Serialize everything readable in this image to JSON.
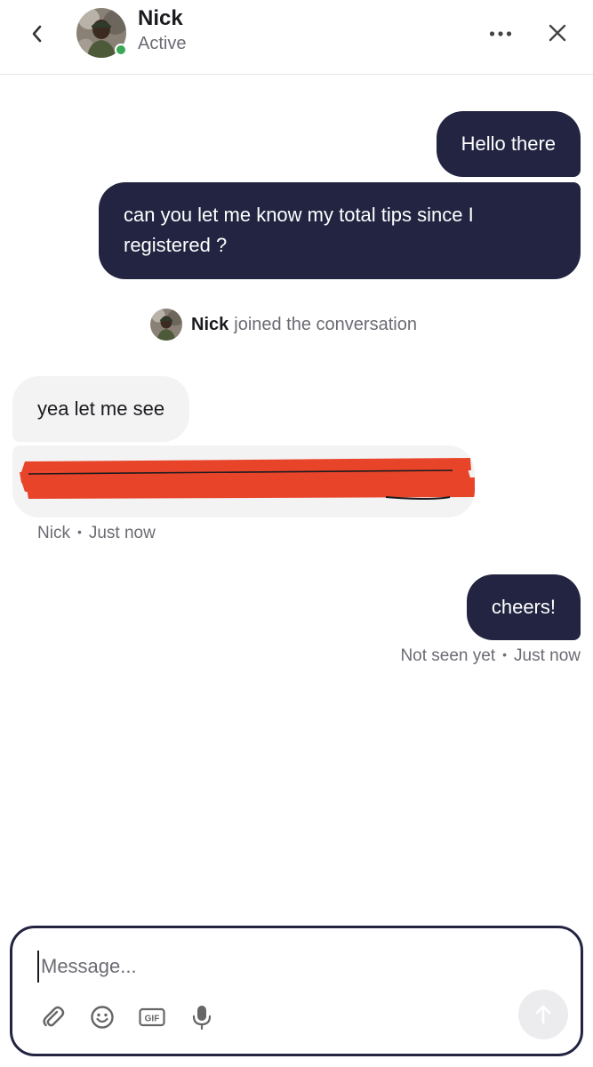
{
  "header": {
    "name": "Nick",
    "status": "Active"
  },
  "messages": [
    {
      "text": "Hello there"
    },
    {
      "text": "can you let me know my total tips since I registered ?"
    },
    {
      "text": "yea let me see"
    },
    {
      "text": "cheers!"
    }
  ],
  "joined": {
    "name": "Nick",
    "text": "joined the conversation"
  },
  "meta_in": {
    "sender": "Nick",
    "time": "Just now"
  },
  "meta_out": {
    "status": "Not seen yet",
    "time": "Just now"
  },
  "composer": {
    "placeholder": "Message...",
    "gif_label": "GIF"
  },
  "colors": {
    "outgoing_bubble": "#222441",
    "incoming_bubble": "#f3f3f4",
    "active_dot": "#3aa856",
    "redaction": "#e8442a"
  },
  "icons": [
    "back-icon",
    "more-icon",
    "close-icon",
    "attach-icon",
    "emoji-icon",
    "gif-icon",
    "mic-icon",
    "send-arrow-icon"
  ]
}
